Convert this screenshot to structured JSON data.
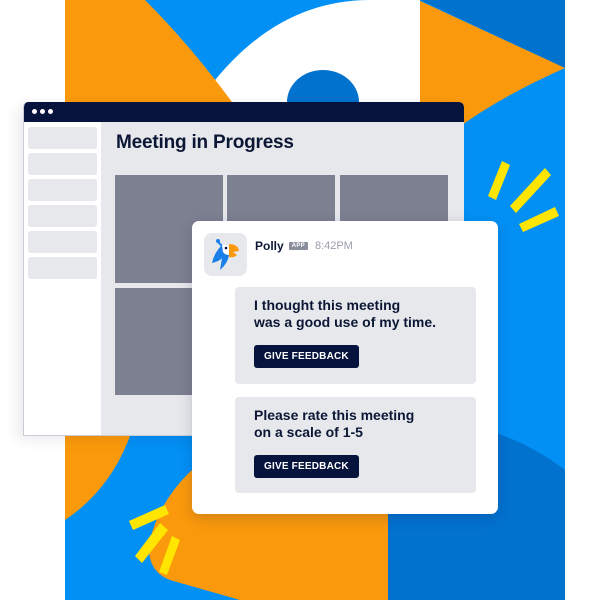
{
  "meeting_window": {
    "title": "Meeting in Progress",
    "sidebar_item_count": 6,
    "video_tiles": 5
  },
  "chat": {
    "sender": "Polly",
    "badge": "APP",
    "time": "8:42PM",
    "avatar_icon": "parrot-icon",
    "messages": [
      {
        "text_line1": "I thought this meeting",
        "text_line2": "was a good use of my time.",
        "button_label": "GIVE FEEDBACK"
      },
      {
        "text_line1": "Please rate this meeting",
        "text_line2": "on a scale of 1-5",
        "button_label": "GIVE FEEDBACK"
      }
    ]
  },
  "colors": {
    "orange": "#fa990c",
    "blue": "#0390f5",
    "dark_blue": "#0272cf",
    "yellow": "#ffe500",
    "navy": "#06133d",
    "panel_gray": "#e6e8ec",
    "tile_gray": "#7d8090"
  }
}
